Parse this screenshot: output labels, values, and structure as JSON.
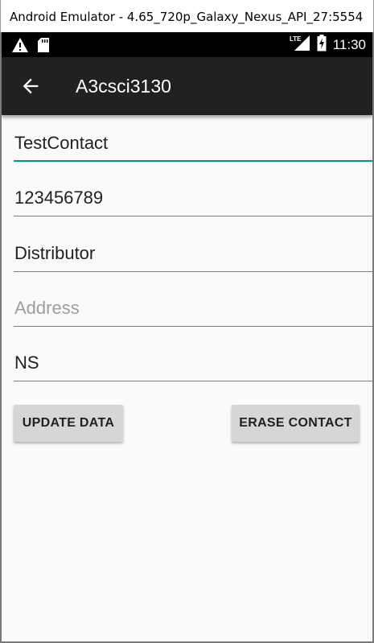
{
  "window": {
    "title": "Android Emulator - 4.65_720p_Galaxy_Nexus_API_27:5554"
  },
  "status_bar": {
    "time": "11:30",
    "left_icons": [
      "warning-icon",
      "sd-card-icon"
    ],
    "right_icons": [
      "lte-signal-icon",
      "battery-charging-icon"
    ],
    "network_label": "LTE"
  },
  "app_bar": {
    "title": "A3csci3130",
    "back_icon": "arrow-back-icon"
  },
  "form": {
    "name": {
      "value": "TestContact"
    },
    "number": {
      "value": "123456789"
    },
    "business": {
      "value": "Distributor"
    },
    "address": {
      "value": "",
      "placeholder": "Address"
    },
    "province": {
      "value": "NS"
    }
  },
  "buttons": {
    "update_label": "UPDATE DATA",
    "erase_label": "ERASE CONTACT"
  },
  "colors": {
    "app_bar": "#212121",
    "status_bar": "#000000",
    "accent": "#009688",
    "background": "#fafafa",
    "button": "#d6d6d6"
  }
}
